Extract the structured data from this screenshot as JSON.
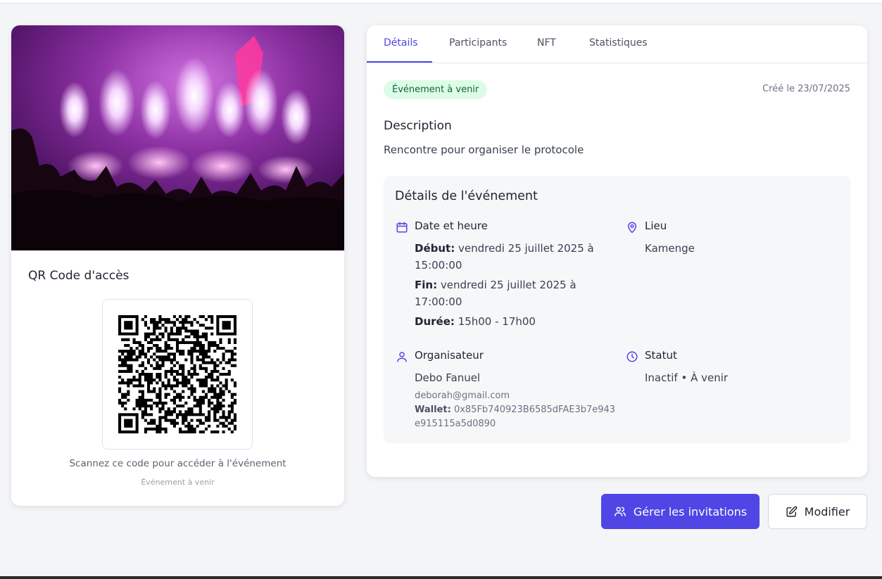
{
  "left_card": {
    "hero_image": "concert-crowd-fireworks",
    "qr_title": "QR Code d'accès",
    "qr_caption": "Scannez ce code pour accéder à l'événement",
    "qr_sub": "Événement à venir"
  },
  "tabs": [
    {
      "label": "Détails",
      "active": true
    },
    {
      "label": "Participants",
      "active": false
    },
    {
      "label": "NFT",
      "active": false
    },
    {
      "label": "Statistiques",
      "active": false
    }
  ],
  "status_badge": "Événement à venir",
  "created": "Créé le 23/07/2025",
  "description": {
    "title": "Description",
    "text": "Rencontre pour organiser le protocole"
  },
  "details": {
    "title": "Détails de l'événement",
    "date": {
      "icon": "calendar-icon",
      "title": "Date et heure",
      "start_label": "Début:",
      "start_value_1": "vendredi 25 juillet 2025 à",
      "start_value_2": "15:00:00",
      "end_label": "Fin:",
      "end_value_1": "vendredi 25 juillet 2025 à",
      "end_value_2": "17:00:00",
      "duration_label": "Durée:",
      "duration_value": "15h00 - 17h00"
    },
    "location": {
      "icon": "map-pin-icon",
      "title": "Lieu",
      "value": "Kamenge"
    },
    "organizer": {
      "icon": "user-icon",
      "title": "Organisateur",
      "name": "Debo Fanuel",
      "email": "deborah@gmail.com",
      "wallet_label": "Wallet:",
      "wallet_1": "0x85Fb740923B6585dFAE3b7e943",
      "wallet_2": "e915115a5d0890"
    },
    "status": {
      "icon": "clock-icon",
      "title": "Statut",
      "value": "Inactif • À venir"
    }
  },
  "actions": {
    "invitations": "Gérer les invitations",
    "edit": "Modifier"
  },
  "colors": {
    "accent": "#4f46e5",
    "badge_bg": "#dcfce7",
    "badge_text": "#166534"
  }
}
